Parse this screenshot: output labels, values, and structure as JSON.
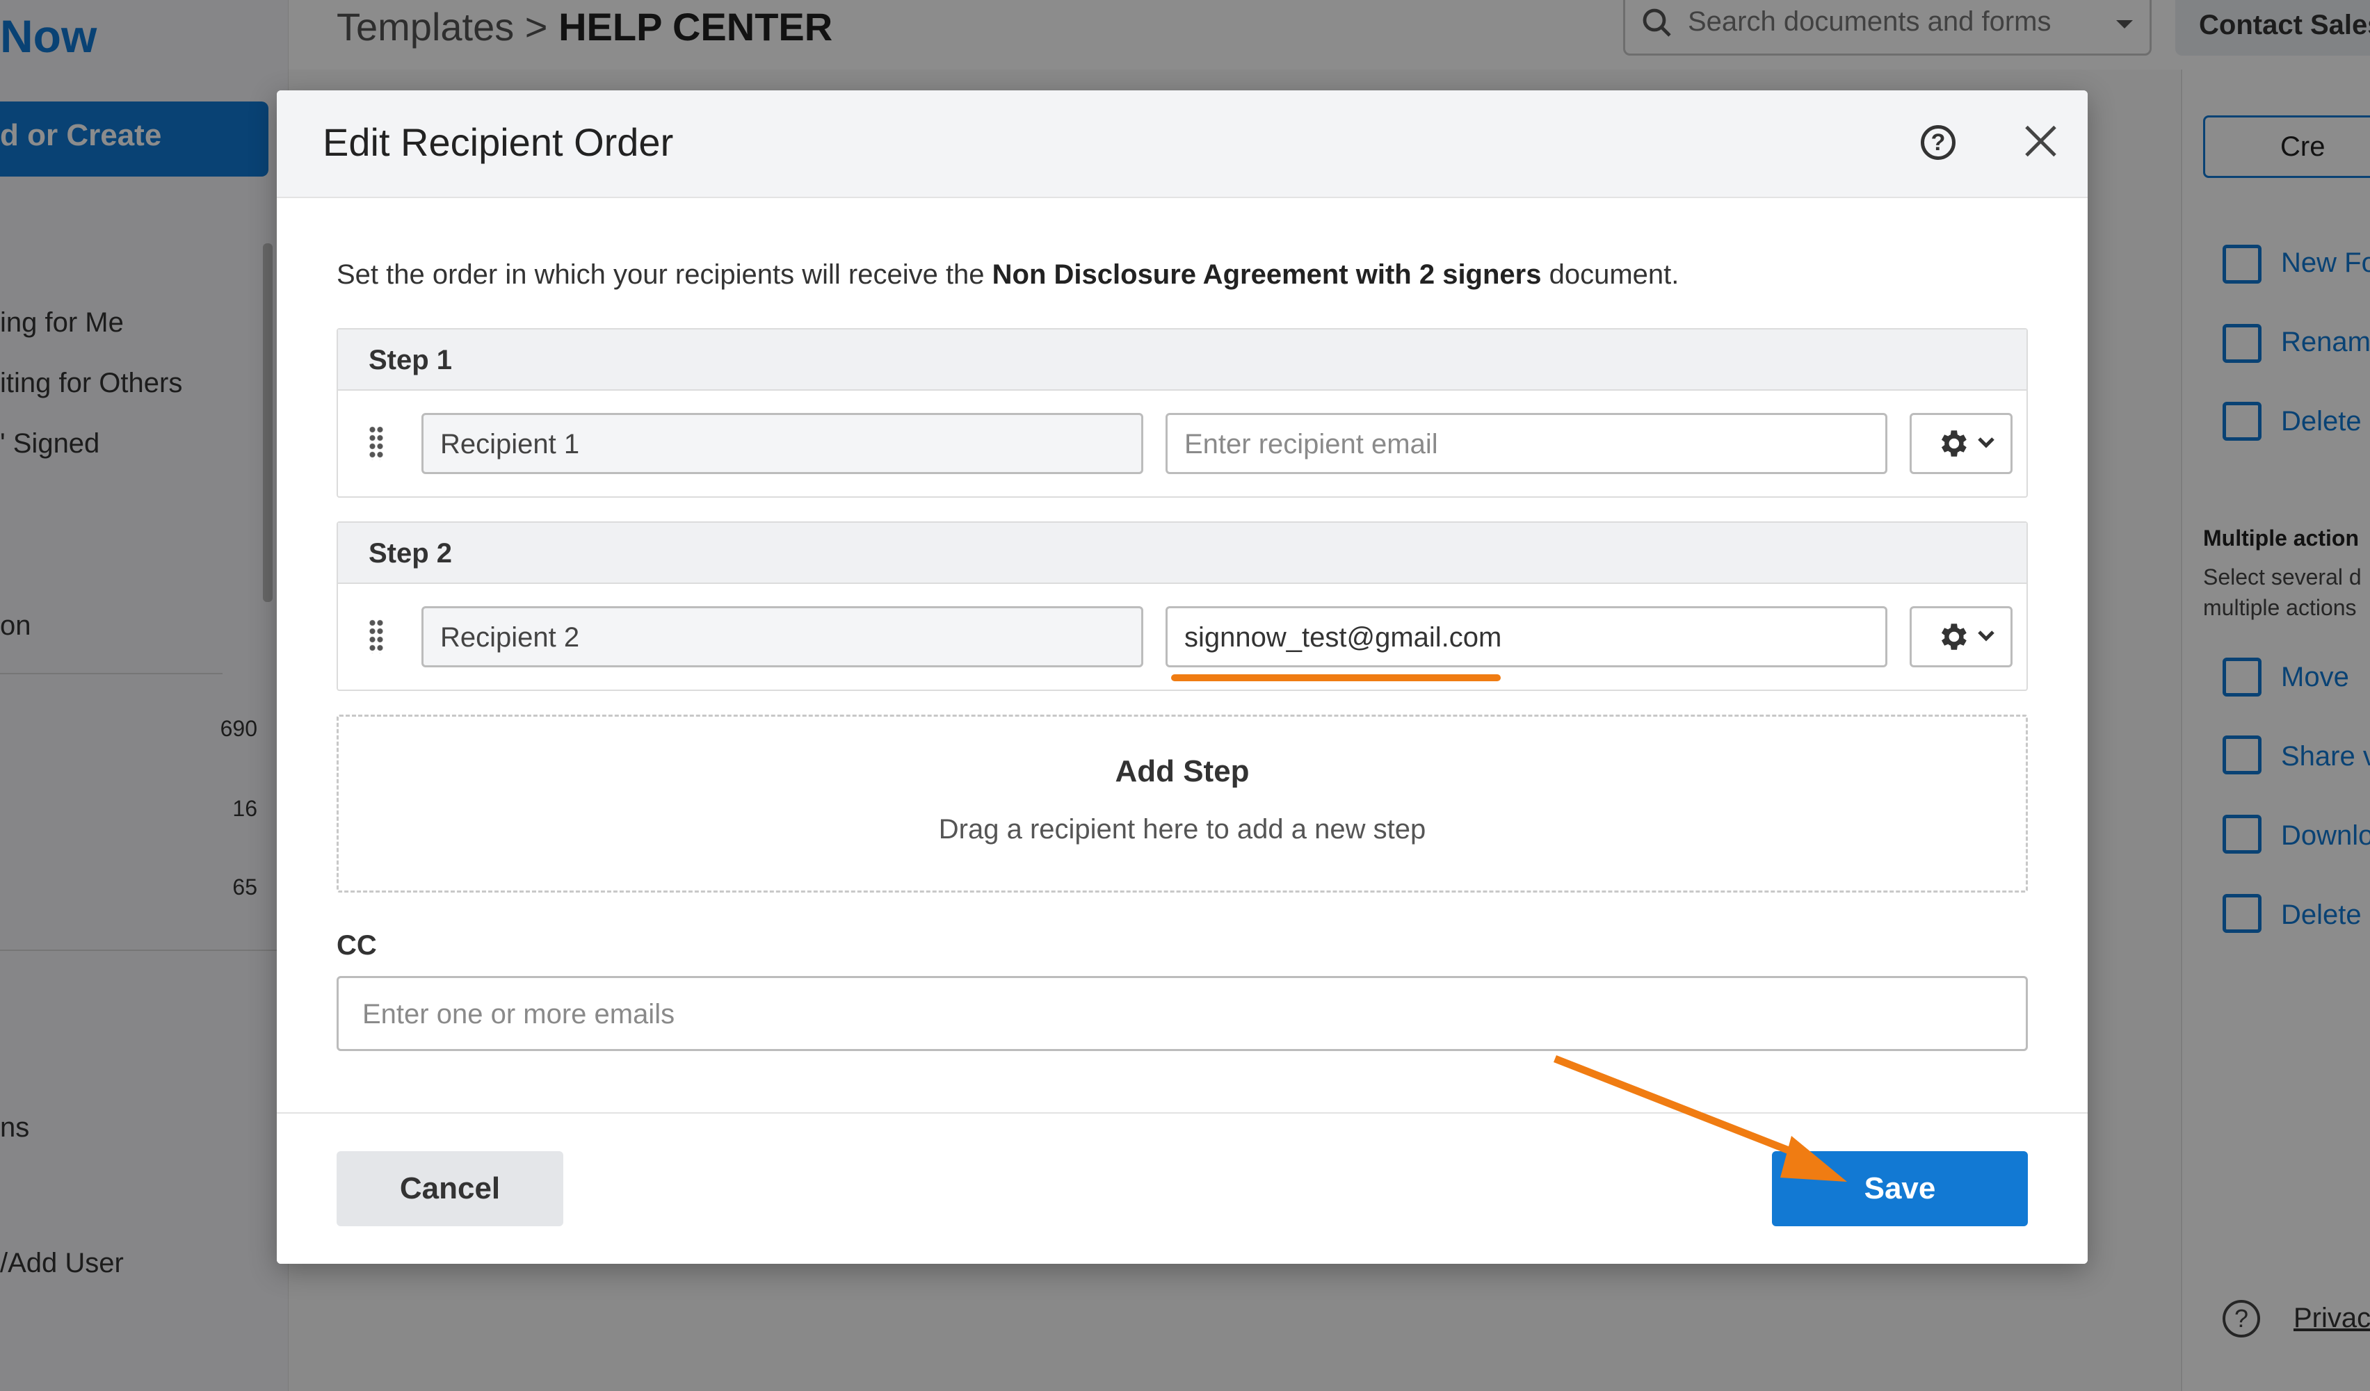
{
  "background": {
    "logo": "Now",
    "upload_button": "d or Create",
    "nav_items": [
      "ing for Me",
      "iting for Others",
      "' Signed",
      "on",
      "ns",
      "/Add User"
    ],
    "counts": [
      "690",
      "16",
      "65"
    ],
    "breadcrumb": {
      "parent": "Templates",
      "separator": ">",
      "current": "HELP CENTER"
    },
    "search_placeholder": "Search documents and forms",
    "contact_sales": "Contact Sales",
    "create_button": "Cre",
    "right_actions": [
      "New Fo",
      "Renam",
      "Delete",
      "Move",
      "Share v",
      "Downlo",
      "Delete"
    ],
    "multiple_title": "Multiple action",
    "multiple_desc_1": "Select several d",
    "multiple_desc_2": "multiple actions",
    "privacy": "Privac"
  },
  "modal": {
    "title": "Edit Recipient Order",
    "help_symbol": "?",
    "intro_prefix": "Set the order in which your recipients will receive the ",
    "intro_document": "Non Disclosure Agreement with 2 signers",
    "intro_suffix": " document.",
    "steps": [
      {
        "label": "Step 1",
        "recipient": "Recipient 1",
        "email": "",
        "email_placeholder": "Enter recipient email"
      },
      {
        "label": "Step 2",
        "recipient": "Recipient 2",
        "email": "signnow_test@gmail.com",
        "email_placeholder": "Enter recipient email"
      }
    ],
    "add_step": {
      "title": "Add Step",
      "subtitle": "Drag a recipient here to add a new step"
    },
    "cc": {
      "label": "CC",
      "placeholder": "Enter one or more emails"
    },
    "cancel_label": "Cancel",
    "save_label": "Save"
  },
  "colors": {
    "accent": "#1279d3",
    "annotation": "#f07c12"
  }
}
